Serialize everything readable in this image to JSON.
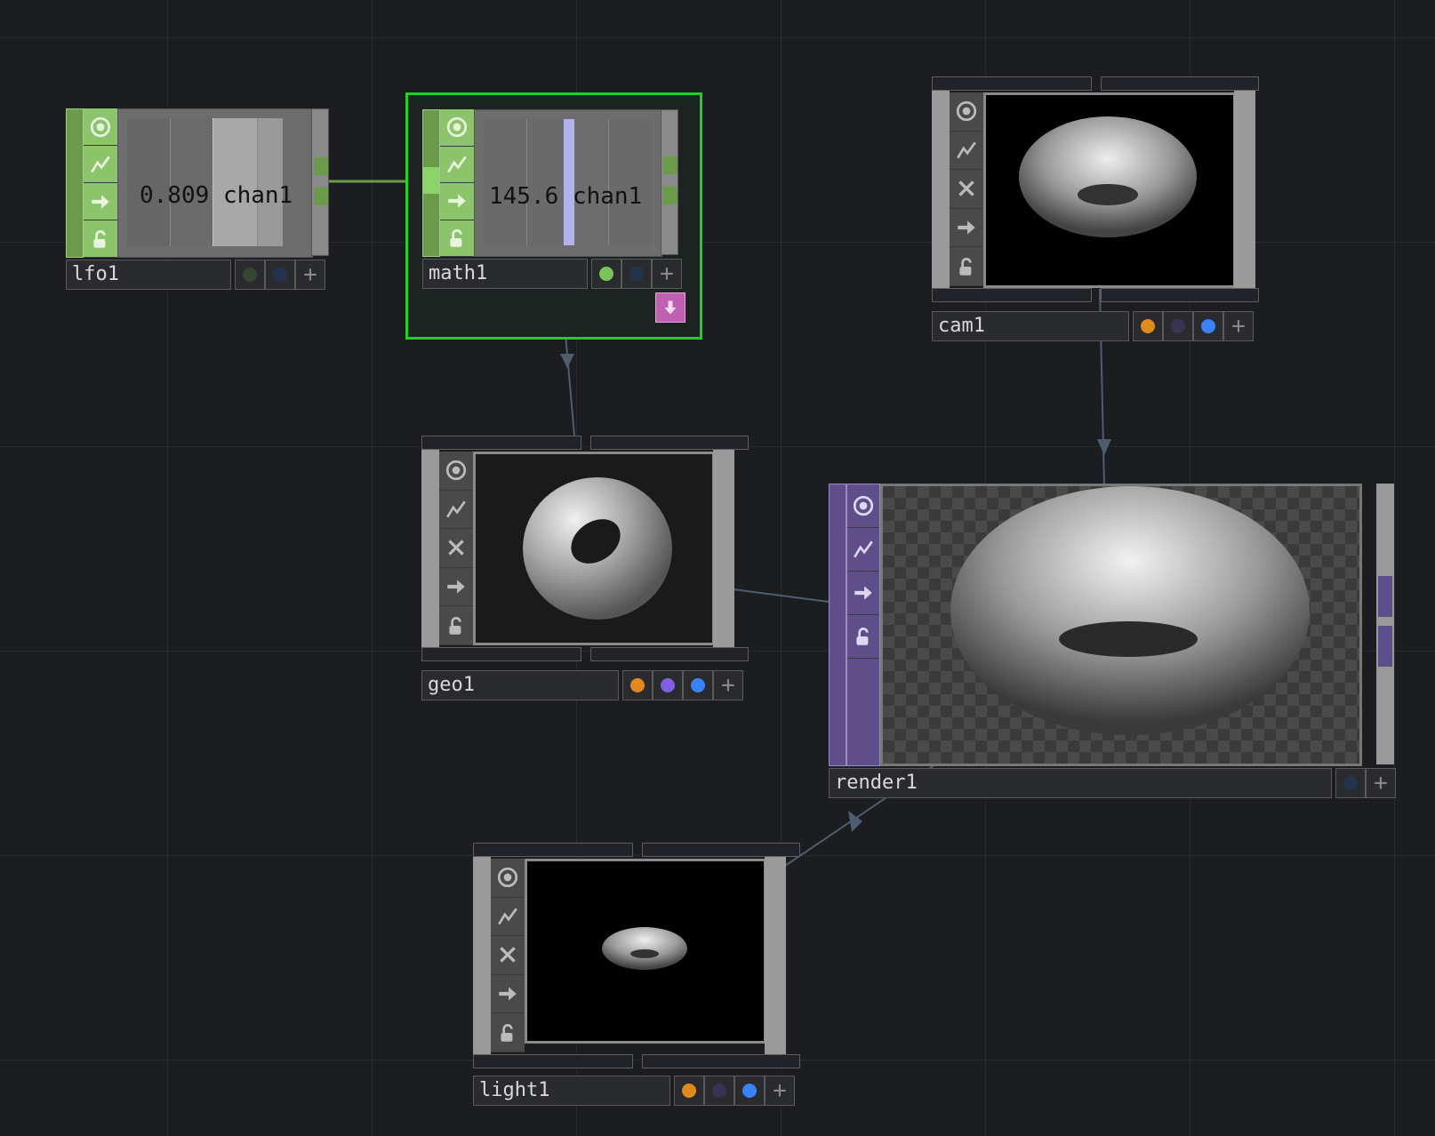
{
  "nodes": {
    "lfo1": {
      "name": "lfo1",
      "value": "0.809",
      "channel": "chan1"
    },
    "math1": {
      "name": "math1",
      "value": "145.6",
      "channel": "chan1"
    },
    "cam1": {
      "name": "cam1"
    },
    "geo1": {
      "name": "geo1"
    },
    "render1": {
      "name": "render1"
    },
    "light1": {
      "name": "light1"
    }
  },
  "icons": [
    "viewer-icon",
    "bypass-icon",
    "cook-icon",
    "export-icon",
    "lock-icon"
  ],
  "colors": {
    "background": "#1c1d21",
    "chop_family": "#6b9a4a",
    "chop_sidebar": "#8bc46a",
    "top_family": "#5e4e8a",
    "selection": "#22d022",
    "orange_flag": "#e08a1e",
    "purple_flag": "#8060e0",
    "blue_flag": "#3b82f6",
    "green_flag": "#7cc45a",
    "display_flag": "#c060b0"
  }
}
